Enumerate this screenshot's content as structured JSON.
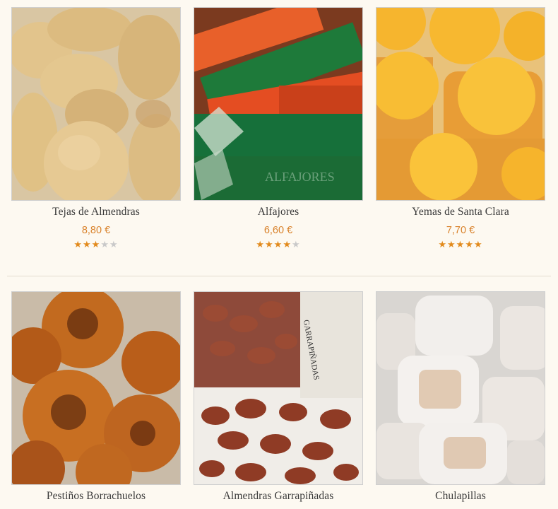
{
  "products": [
    {
      "name": "Tejas de Almendras",
      "price": "8,80 €",
      "rating": 3,
      "max_rating": 5,
      "image": "tejas-almendras-photo"
    },
    {
      "name": "Alfajores",
      "price": "6,60 €",
      "rating": 4,
      "max_rating": 5,
      "image": "alfajores-photo",
      "image_text": "ALFAJORES"
    },
    {
      "name": "Yemas de Santa Clara",
      "price": "7,70 €",
      "rating": 5,
      "max_rating": 5,
      "image": "yemas-santa-clara-photo"
    },
    {
      "name": "Pestiños Borrachuelos",
      "image": "pestinos-borrachuelos-photo"
    },
    {
      "name": "Almendras Garrapiñadas",
      "image": "almendras-garrapinadas-photo",
      "image_text": "GARRAPIÑADAS"
    },
    {
      "name": "Chulapillas",
      "image": "chulapillas-photo"
    }
  ],
  "colors": {
    "price": "#d9822b",
    "star_on": "#e28a1c",
    "star_off": "#c9c9c9",
    "background": "#fdf9f1"
  }
}
